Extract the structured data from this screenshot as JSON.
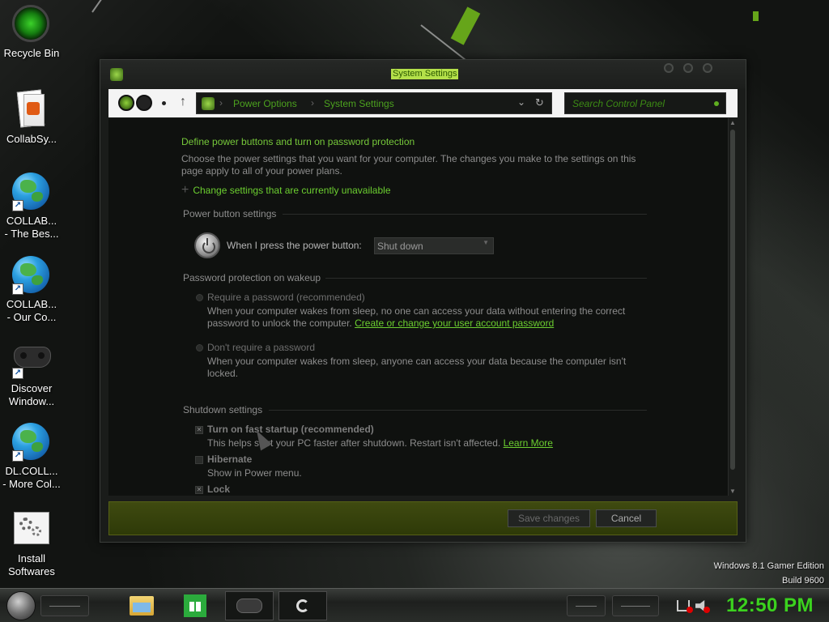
{
  "colors": {
    "accent_green": "#76c83a",
    "clock_green": "#3bd21e",
    "footer_olive": "#3f4a10"
  },
  "desktop": {
    "icons": [
      {
        "label": "Recycle Bin",
        "icon": "recycle-bin-icon"
      },
      {
        "label": "CollabSy...",
        "icon": "document-icon"
      },
      {
        "label": "COLLAB...\n- The Bes...",
        "icon": "globe-icon"
      },
      {
        "label": "COLLAB...\n- Our Co...",
        "icon": "globe-icon"
      },
      {
        "label": "Discover\nWindow...",
        "icon": "gamepad-icon"
      },
      {
        "label": "DL.COLL...\n- More Col...",
        "icon": "globe-icon"
      },
      {
        "label": "Install\nSoftwares",
        "icon": "gears-icon"
      }
    ],
    "watermark": {
      "line1": "Windows 8.1 Gamer Edition",
      "line2": "Build 9600"
    }
  },
  "window": {
    "title": "System Settings",
    "breadcrumb": [
      "Power Options",
      "System Settings"
    ],
    "search_placeholder": "Search Control Panel",
    "heading": "Define power buttons and turn on password protection",
    "description": "Choose the power settings that you want for your computer. The changes you make to the settings on this page apply to all of your power plans.",
    "change_unavailable_link": "Change settings that are currently unavailable",
    "power_button": {
      "section_title": "Power button settings",
      "label": "When I press the power button:",
      "value": "Shut down"
    },
    "password": {
      "section_title": "Password protection on wakeup",
      "require_label": "Require a password (recommended)",
      "require_desc": "When your computer wakes from sleep, no one can access your data without entering the correct password to unlock the computer.",
      "require_link": "Create or change your user account password",
      "dont_label": "Don't require a password",
      "dont_desc": "When your computer wakes from sleep, anyone can access your data because the computer isn't locked."
    },
    "shutdown": {
      "section_title": "Shutdown settings",
      "fast_startup_label": "Turn on fast startup (recommended)",
      "fast_startup_desc": "This helps start your PC faster after shutdown. Restart isn't affected.",
      "learn_more": "Learn More",
      "hibernate_label": "Hibernate",
      "hibernate_desc": "Show in Power menu.",
      "lock_label": "Lock"
    },
    "buttons": {
      "save": "Save changes",
      "cancel": "Cancel"
    }
  },
  "taskbar": {
    "clock": "12:50 PM",
    "pinned": [
      "file-explorer-icon",
      "store-icon",
      "gamepad-icon",
      "app-ring-icon"
    ]
  }
}
